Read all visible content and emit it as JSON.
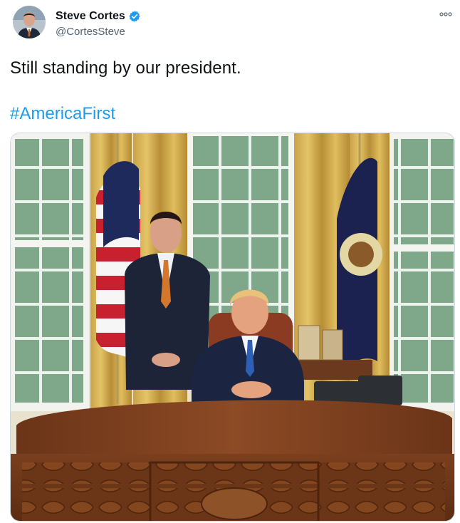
{
  "tweet": {
    "author": {
      "display_name": "Steve Cortes",
      "handle": "@CortesSteve",
      "verified": true,
      "verified_icon": "verified-badge-icon"
    },
    "text": "Still standing by our president.",
    "hashtag": "#AmericaFirst",
    "more_icon": "more-options-icon",
    "colors": {
      "link": "#1d9bf0",
      "verified": "#1d9bf0",
      "secondary_text": "#536471"
    }
  }
}
